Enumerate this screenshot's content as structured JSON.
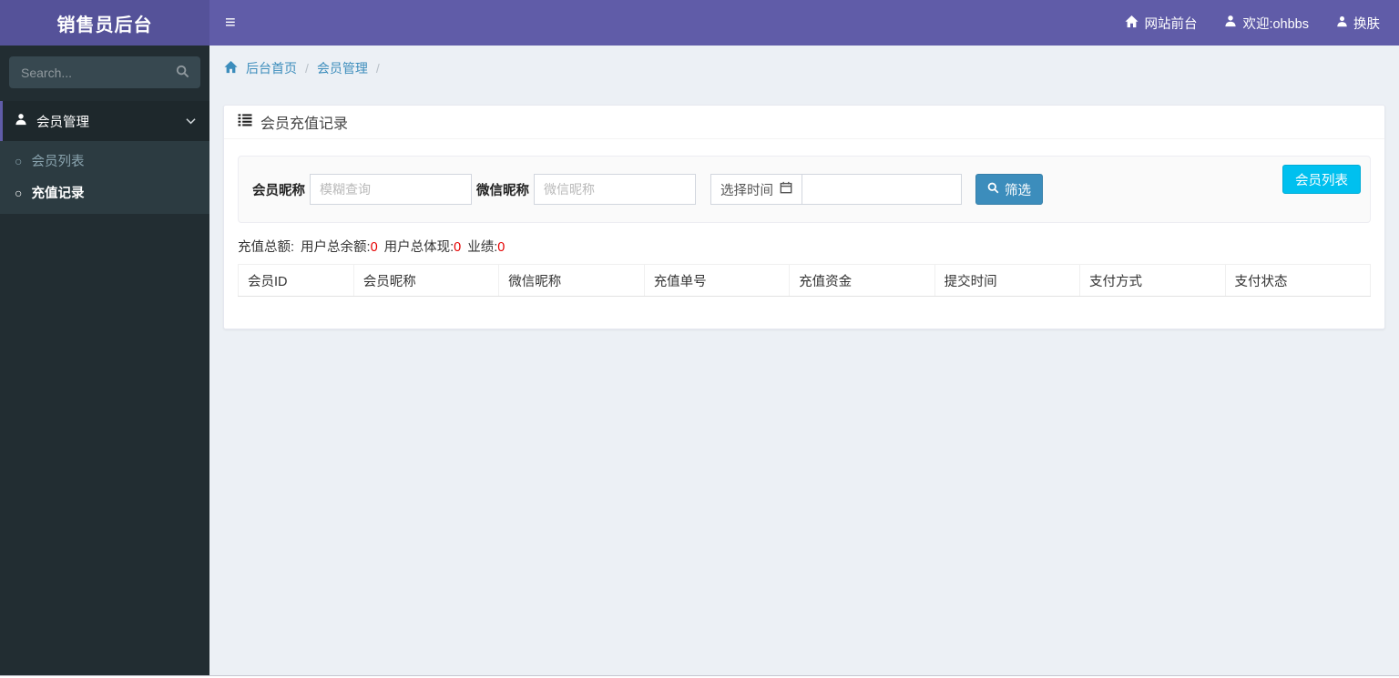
{
  "app_title": "销售员后台",
  "topbar": {
    "site_front_label": "网站前台",
    "welcome_label": "欢迎:ohbbs",
    "change_skin_label": "换肤"
  },
  "sidebar": {
    "search_placeholder": "Search...",
    "menu_label": "会员管理",
    "submenu": [
      {
        "label": "会员列表"
      },
      {
        "label": "充值记录"
      }
    ]
  },
  "breadcrumb": {
    "home": "后台首页",
    "section": "会员管理",
    "separator": "/"
  },
  "panel": {
    "title": "会员充值记录",
    "filter": {
      "member_nick_label": "会员昵称",
      "member_nick_placeholder": "模糊查询",
      "wechat_nick_label": "微信昵称",
      "wechat_nick_placeholder": "微信昵称",
      "time_label": "选择时间",
      "time_value": "",
      "filter_button_label": "筛选",
      "member_list_button_label": "会员列表"
    },
    "stats": [
      {
        "label": "充值总额:",
        "value": ""
      },
      {
        "label": "用户总余额:",
        "value": "0"
      },
      {
        "label": "用户总体现:",
        "value": "0"
      },
      {
        "label": "业绩:",
        "value": "0"
      }
    ],
    "table": {
      "columns": [
        "会员ID",
        "会员昵称",
        "微信昵称",
        "充值单号",
        "充值资金",
        "提交时间",
        "支付方式",
        "支付状态"
      ],
      "rows": []
    }
  },
  "colors": {
    "navbar": "#605ca8",
    "logo_bg": "#555299",
    "sidebar_bg": "#222d32",
    "submenu_bg": "#2c3b41",
    "active_item_bg": "#1e282c",
    "content_bg": "#ecf0f5",
    "link": "#3c8dbc",
    "filter_button": "#3c8dbc",
    "member_list_button": "#00c0ef",
    "stat_value_red": "#e50000"
  }
}
